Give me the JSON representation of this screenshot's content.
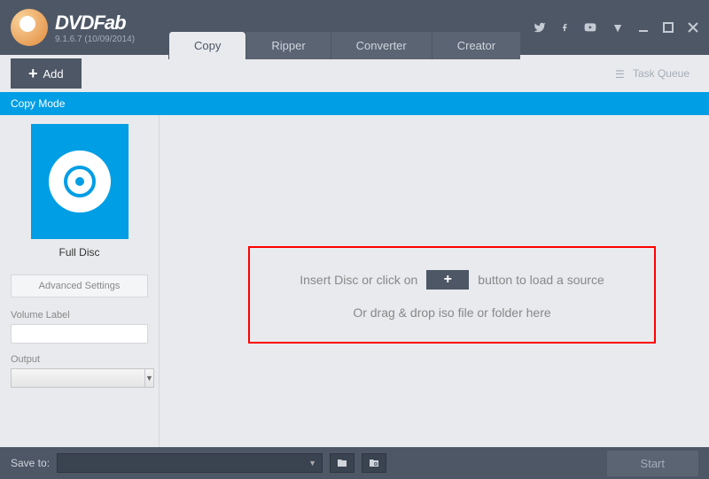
{
  "app": {
    "name": "DVDFab",
    "version": "9.1.6.7 (10/09/2014)"
  },
  "tabs": [
    {
      "label": "Copy",
      "active": true
    },
    {
      "label": "Ripper",
      "active": false
    },
    {
      "label": "Converter",
      "active": false
    },
    {
      "label": "Creator",
      "active": false
    }
  ],
  "toolbar": {
    "add_label": "Add",
    "task_queue_label": "Task Queue"
  },
  "mode_bar": {
    "label": "Copy Mode"
  },
  "sidebar": {
    "mode_label": "Full Disc",
    "advanced_settings_label": "Advanced Settings",
    "volume_label": "Volume Label",
    "volume_value": "",
    "output_label": "Output",
    "output_value": ""
  },
  "drop": {
    "prefix": "Insert Disc or click on",
    "suffix": "button to load a source",
    "line2": "Or drag & drop iso file or folder here"
  },
  "status": {
    "save_to_label": "Save to:",
    "save_to_value": "",
    "start_label": "Start"
  },
  "titlebar_icons": {
    "twitter": "twitter-icon",
    "facebook": "facebook-icon",
    "youtube": "youtube-icon",
    "menu": "menu-dropdown-icon",
    "minimize": "minimize-icon",
    "maximize": "maximize-icon",
    "close": "close-icon"
  }
}
